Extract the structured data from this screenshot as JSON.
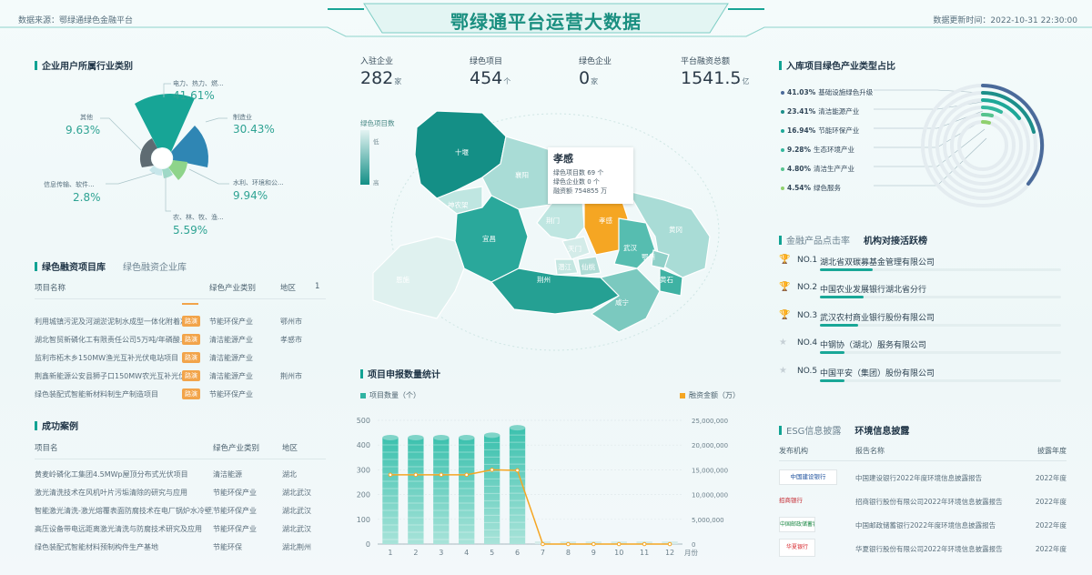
{
  "header": {
    "source": "数据来源：鄂绿通绿色金融平台",
    "title": "鄂绿通平台运营大数据",
    "updated": "数据更新时间：2022-10-31 22:30:00"
  },
  "industry": {
    "title": "企业用户所属行业类别",
    "labels": [
      {
        "name": "电力、热力、燃...",
        "pct": "41.61%"
      },
      {
        "name": "制造业",
        "pct": "30.43%"
      },
      {
        "name": "水利、环境和公...",
        "pct": "9.94%"
      },
      {
        "name": "农、林、牧、渔...",
        "pct": "5.59%"
      },
      {
        "name": "信息传输、软件...",
        "pct": "2.8%"
      },
      {
        "name": "其他",
        "pct": "9.63%"
      }
    ]
  },
  "finance_projects": {
    "tab_active": "绿色融资项目库",
    "tab_inactive": "绿色融资企业库",
    "headers": [
      "项目名称",
      "绿色产业类别",
      "地区"
    ],
    "page": "1",
    "rows": [
      {
        "name": "利用城镇污泥及河湖淤泥制水成型一体化附着净...",
        "tag": "路演",
        "cat": "节能环保产业",
        "region": "鄂州市"
      },
      {
        "name": "湖北智贸新磷化工有限责任公司5万吨/年磷酸...",
        "tag": "路演",
        "cat": "清洁能源产业",
        "region": "孝感市"
      },
      {
        "name": "监利市柘木乡150MW渔光互补光伏电站项目",
        "tag": "路演",
        "cat": "清洁能源产业",
        "region": ""
      },
      {
        "name": "荆鑫新能源公安县狮子口150MW农光互补光伏发...",
        "tag": "路演",
        "cat": "清洁能源产业",
        "region": "荆州市"
      },
      {
        "name": "绿色装配式智能新材料制生产制造项目",
        "tag": "路演",
        "cat": "节能环保产业",
        "region": ""
      }
    ]
  },
  "cases": {
    "title": "成功案例",
    "headers": [
      "项目名",
      "绿色产业类别",
      "地区"
    ],
    "rows": [
      {
        "name": "黄麦岭磷化工集团4.5MWp屋顶分布式光伏项目",
        "cat": "清洁能源",
        "region": "湖北"
      },
      {
        "name": "激光清洗技术在风机叶片污垢清除的研究与应用",
        "cat": "节能环保产业",
        "region": "湖北武汉"
      },
      {
        "name": "智能激光清洗-激光熔覆表面防腐技术在电厂锅炉水冷壁及...",
        "cat": "节能环保产业",
        "region": "湖北武汉"
      },
      {
        "name": "高压设备带电远距离激光清洗与防腐技术研究及应用",
        "cat": "节能环保产业",
        "region": "湖北武汉"
      },
      {
        "name": "绿色装配式智能材料预制构件生产基地",
        "cat": "节能环保",
        "region": "湖北荆州"
      }
    ]
  },
  "kpis": [
    {
      "label": "入驻企业",
      "value": "282",
      "unit": "家"
    },
    {
      "label": "绿色项目",
      "value": "454",
      "unit": "个"
    },
    {
      "label": "绿色企业",
      "value": "0",
      "unit": "家"
    },
    {
      "label": "平台融资总额",
      "value": "1541.5",
      "unit": "亿"
    }
  ],
  "map": {
    "legend_title": "绿色项目数",
    "legend_low": "低",
    "legend_high": "高",
    "regions": [
      "十堰",
      "襄阳",
      "神农架",
      "宜昌",
      "荆门",
      "孝感",
      "恩施",
      "天门",
      "潜江",
      "仙桃",
      "武汉",
      "鄂州",
      "黄冈",
      "黄石",
      "荆州",
      "咸宁"
    ],
    "tooltip": {
      "title": "孝感",
      "lines": [
        "绿色项目数 69 个",
        "绿色企业数 0 个",
        "融资额 754855 万"
      ]
    }
  },
  "project_stats": {
    "title": "项目申报数量统计",
    "legend_left": "项目数量（个）",
    "legend_right": "融资金额（万）",
    "colors": {
      "bar": "#2fb3a2",
      "line": "#f5a623"
    },
    "chart_data": {
      "type": "bar",
      "categories": [
        "1",
        "2",
        "3",
        "4",
        "5",
        "6",
        "7",
        "8",
        "9",
        "10",
        "11",
        "12"
      ],
      "x_unit": "月份",
      "series": [
        {
          "name": "项目数量（个）",
          "type": "bar",
          "values": [
            430,
            430,
            430,
            430,
            440,
            470,
            0,
            0,
            0,
            0,
            0,
            0
          ]
        },
        {
          "name": "融资金额（万）",
          "type": "line",
          "values": [
            14000000,
            14000000,
            14000000,
            14000000,
            15000000,
            14900000,
            0,
            0,
            0,
            0,
            0,
            0
          ]
        }
      ],
      "y_left": {
        "range": [
          0,
          500
        ],
        "ticks": [
          "0",
          "100",
          "200",
          "300",
          "400",
          "500"
        ]
      },
      "y_right": {
        "range": [
          0,
          25000000
        ],
        "ticks": [
          "0",
          "5,000,000",
          "10,000,000",
          "15,000,000",
          "20,000,000",
          "25,000,000"
        ]
      }
    }
  },
  "industry_share": {
    "title": "入库项目绿色产业类型占比",
    "items": [
      {
        "pct": "41.03%",
        "name": "基础设施绿色升级",
        "color": "#4a6a9a"
      },
      {
        "pct": "23.41%",
        "name": "清洁能源产业",
        "color": "#1c8f8a"
      },
      {
        "pct": "16.94%",
        "name": "节能环保产业",
        "color": "#1ea898"
      },
      {
        "pct": "9.28%",
        "name": "生态环境产业",
        "color": "#33b79e"
      },
      {
        "pct": "4.80%",
        "name": "清洁生产产业",
        "color": "#55c38e"
      },
      {
        "pct": "4.54%",
        "name": "绿色服务",
        "color": "#8fd06d"
      }
    ]
  },
  "ranking": {
    "tab_inactive": "金融产品点击率",
    "tab_active": "机构对接活跃榜",
    "items": [
      {
        "no": "NO.1",
        "name": "湖北省双碳募基金管理有限公司",
        "fill": 0.22
      },
      {
        "no": "NO.2",
        "name": "中国农业发展银行湖北省分行",
        "fill": 0.18
      },
      {
        "no": "NO.3",
        "name": "武汉农村商业银行股份有限公司",
        "fill": 0.16
      },
      {
        "no": "NO.4",
        "name": "中钢协（湖北）服务有限公司",
        "fill": 0.1
      },
      {
        "no": "NO.5",
        "name": "中国平安（集团）股份有限公司",
        "fill": 0.1
      }
    ]
  },
  "esg": {
    "tab_inactive": "ESG信息披露",
    "tab_active": "环境信息披露",
    "headers": [
      "发布机构",
      "报告名称",
      "披露年度"
    ],
    "rows": [
      {
        "org": "中国建设银行",
        "report": "中国建设银行2022年度环境信息披露报告",
        "year": "2022年度"
      },
      {
        "org": "招商银行",
        "report": "招商银行股份有限公司2022年环境信息披露报告",
        "year": "2022年度"
      },
      {
        "org": "中国邮政储蓄银行",
        "report": "中国邮政储蓄银行2022年度环境信息披露报告",
        "year": "2022年度"
      },
      {
        "org": "华夏银行",
        "report": "华夏银行股份有限公司2022年环境信息披露报告",
        "year": "2022年度"
      }
    ]
  }
}
